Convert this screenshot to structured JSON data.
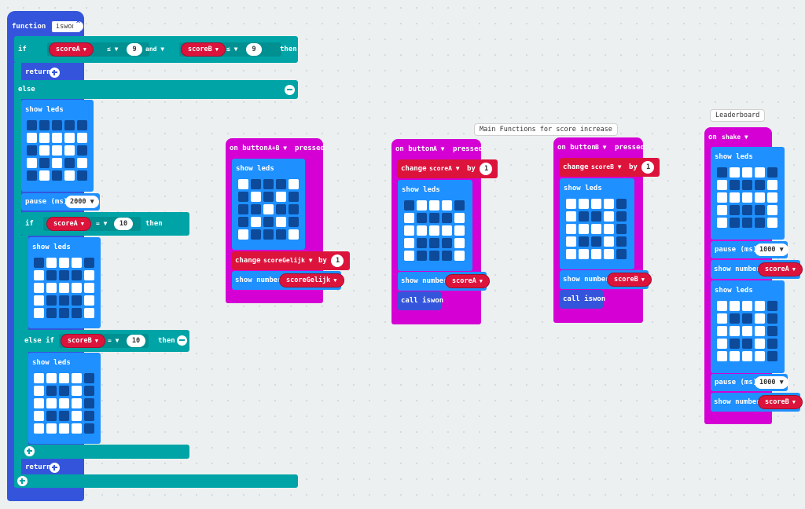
{
  "function_block": {
    "keyword": "function",
    "name": "iswon",
    "if_kw": "if",
    "then_kw": "then",
    "and_kw": "and",
    "else_kw": "else",
    "else_if_kw": "else if",
    "return_kw": "return",
    "lte_op": "≤",
    "eq_op": "=",
    "var_scoreA": "scoreA",
    "var_scoreB": "scoreB",
    "num_9": "9",
    "num_10": "10",
    "show_leds": "show leds",
    "pause_label": "pause (ms)",
    "pause_value": "2000",
    "leds_else": [
      0,
      0,
      0,
      0,
      0,
      1,
      1,
      1,
      1,
      1,
      0,
      1,
      1,
      1,
      0,
      1,
      0,
      1,
      0,
      1,
      0,
      1,
      0,
      1,
      0
    ],
    "leds_a": [
      0,
      1,
      1,
      1,
      0,
      1,
      0,
      0,
      0,
      1,
      1,
      1,
      1,
      1,
      1,
      1,
      0,
      0,
      0,
      1,
      1,
      0,
      0,
      0,
      1
    ],
    "leds_b": [
      1,
      1,
      1,
      1,
      0,
      1,
      0,
      0,
      1,
      0,
      1,
      1,
      1,
      1,
      0,
      1,
      0,
      0,
      1,
      0,
      1,
      1,
      1,
      1,
      0
    ]
  },
  "ab_block": {
    "header": "on button",
    "button": "A+B",
    "pressed": "pressed",
    "show_leds": "show leds",
    "leds": [
      1,
      0,
      0,
      0,
      1,
      0,
      1,
      0,
      1,
      0,
      0,
      0,
      1,
      0,
      0,
      0,
      1,
      0,
      1,
      0,
      1,
      0,
      0,
      0,
      1
    ],
    "change_kw": "change",
    "var": "scoreGelijk",
    "by_kw": "by",
    "amount": "1",
    "show_number": "show number"
  },
  "a_block": {
    "header": "on button",
    "button": "A",
    "pressed": "pressed",
    "change_kw": "change",
    "var": "scoreA",
    "by_kw": "by",
    "amount": "1",
    "show_leds": "show leds",
    "leds": [
      0,
      1,
      1,
      1,
      0,
      1,
      0,
      0,
      0,
      1,
      1,
      1,
      1,
      1,
      1,
      1,
      0,
      0,
      0,
      1,
      1,
      0,
      0,
      0,
      1
    ],
    "show_number": "show number",
    "call": "call iswon"
  },
  "b_block": {
    "header": "on button",
    "button": "B",
    "pressed": "pressed",
    "change_kw": "change",
    "var": "scoreB",
    "by_kw": "by",
    "amount": "1",
    "show_leds": "show leds",
    "leds": [
      1,
      1,
      1,
      1,
      0,
      1,
      0,
      0,
      1,
      0,
      1,
      1,
      1,
      1,
      0,
      1,
      0,
      0,
      1,
      0,
      1,
      1,
      1,
      1,
      0
    ],
    "show_number": "show number",
    "call": "call iswon"
  },
  "shake_block": {
    "header": "on",
    "event": "shake",
    "show_leds": "show leds",
    "leds_a": [
      0,
      1,
      1,
      1,
      0,
      1,
      0,
      0,
      0,
      1,
      1,
      1,
      1,
      1,
      1,
      1,
      0,
      0,
      0,
      1,
      1,
      0,
      0,
      0,
      1
    ],
    "leds_b": [
      1,
      1,
      1,
      1,
      0,
      1,
      0,
      0,
      1,
      0,
      1,
      1,
      1,
      1,
      0,
      1,
      0,
      0,
      1,
      0,
      1,
      1,
      1,
      1,
      0
    ],
    "pause_label": "pause (ms)",
    "pause_value": "1000",
    "show_number": "show number",
    "var_a": "scoreA",
    "var_b": "scoreB"
  },
  "comments": {
    "main": "Main Functions for score increase",
    "leaderboard": "Leaderboard"
  },
  "colors": {
    "functions": "#3455db",
    "logic": "#00a4a6",
    "basic": "#1e90ff",
    "input": "#d400d4",
    "variables": "#dc143c"
  }
}
